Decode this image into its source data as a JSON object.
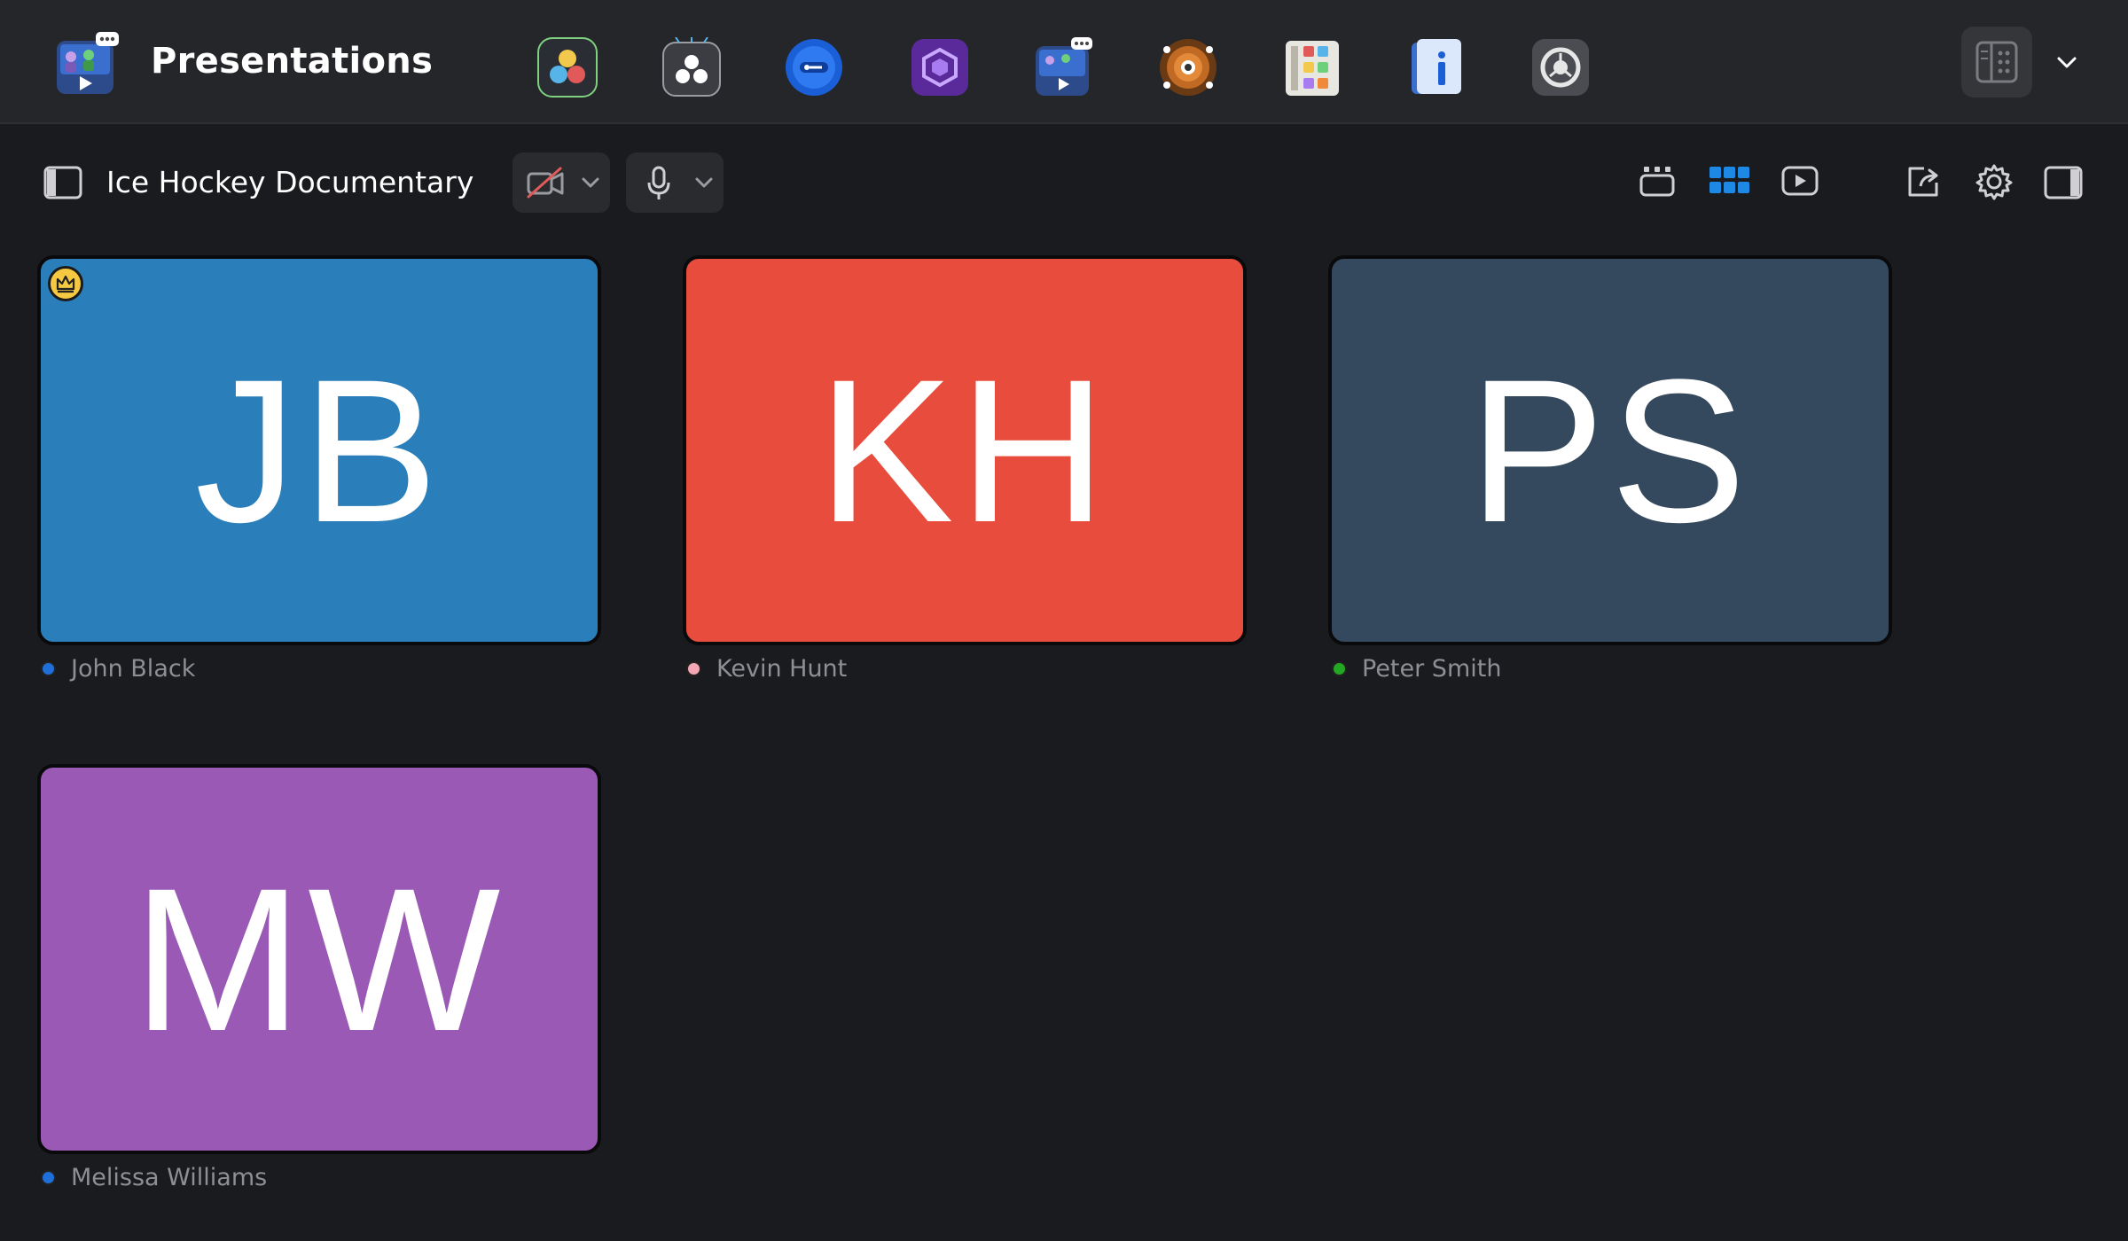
{
  "app": {
    "title": "Presentations",
    "dock_icons": [
      "davinci-resolve-icon",
      "davinci-remote-icon",
      "password-manager-icon",
      "hexagon-app-icon",
      "presentations-app-icon",
      "radar-app-icon",
      "color-grid-app-icon",
      "info-app-icon",
      "system-settings-icon"
    ]
  },
  "meeting": {
    "title": "Ice Hockey Documentary"
  },
  "colors": {
    "accent": "#1e88e5",
    "tile_jb": "#2a7fba",
    "tile_kh": "#e74c3c",
    "tile_ps": "#34495e",
    "tile_mw": "#9b59b6"
  },
  "participants": [
    {
      "initials": "JB",
      "name": "John Black",
      "status_color": "#1e6fd9",
      "host": true
    },
    {
      "initials": "KH",
      "name": "Kevin Hunt",
      "status_color": "#f4a6b4",
      "host": false
    },
    {
      "initials": "PS",
      "name": "Peter Smith",
      "status_color": "#22a822",
      "host": false
    },
    {
      "initials": "MW",
      "name": "Melissa Williams",
      "status_color": "#1e6fd9",
      "host": false
    }
  ]
}
